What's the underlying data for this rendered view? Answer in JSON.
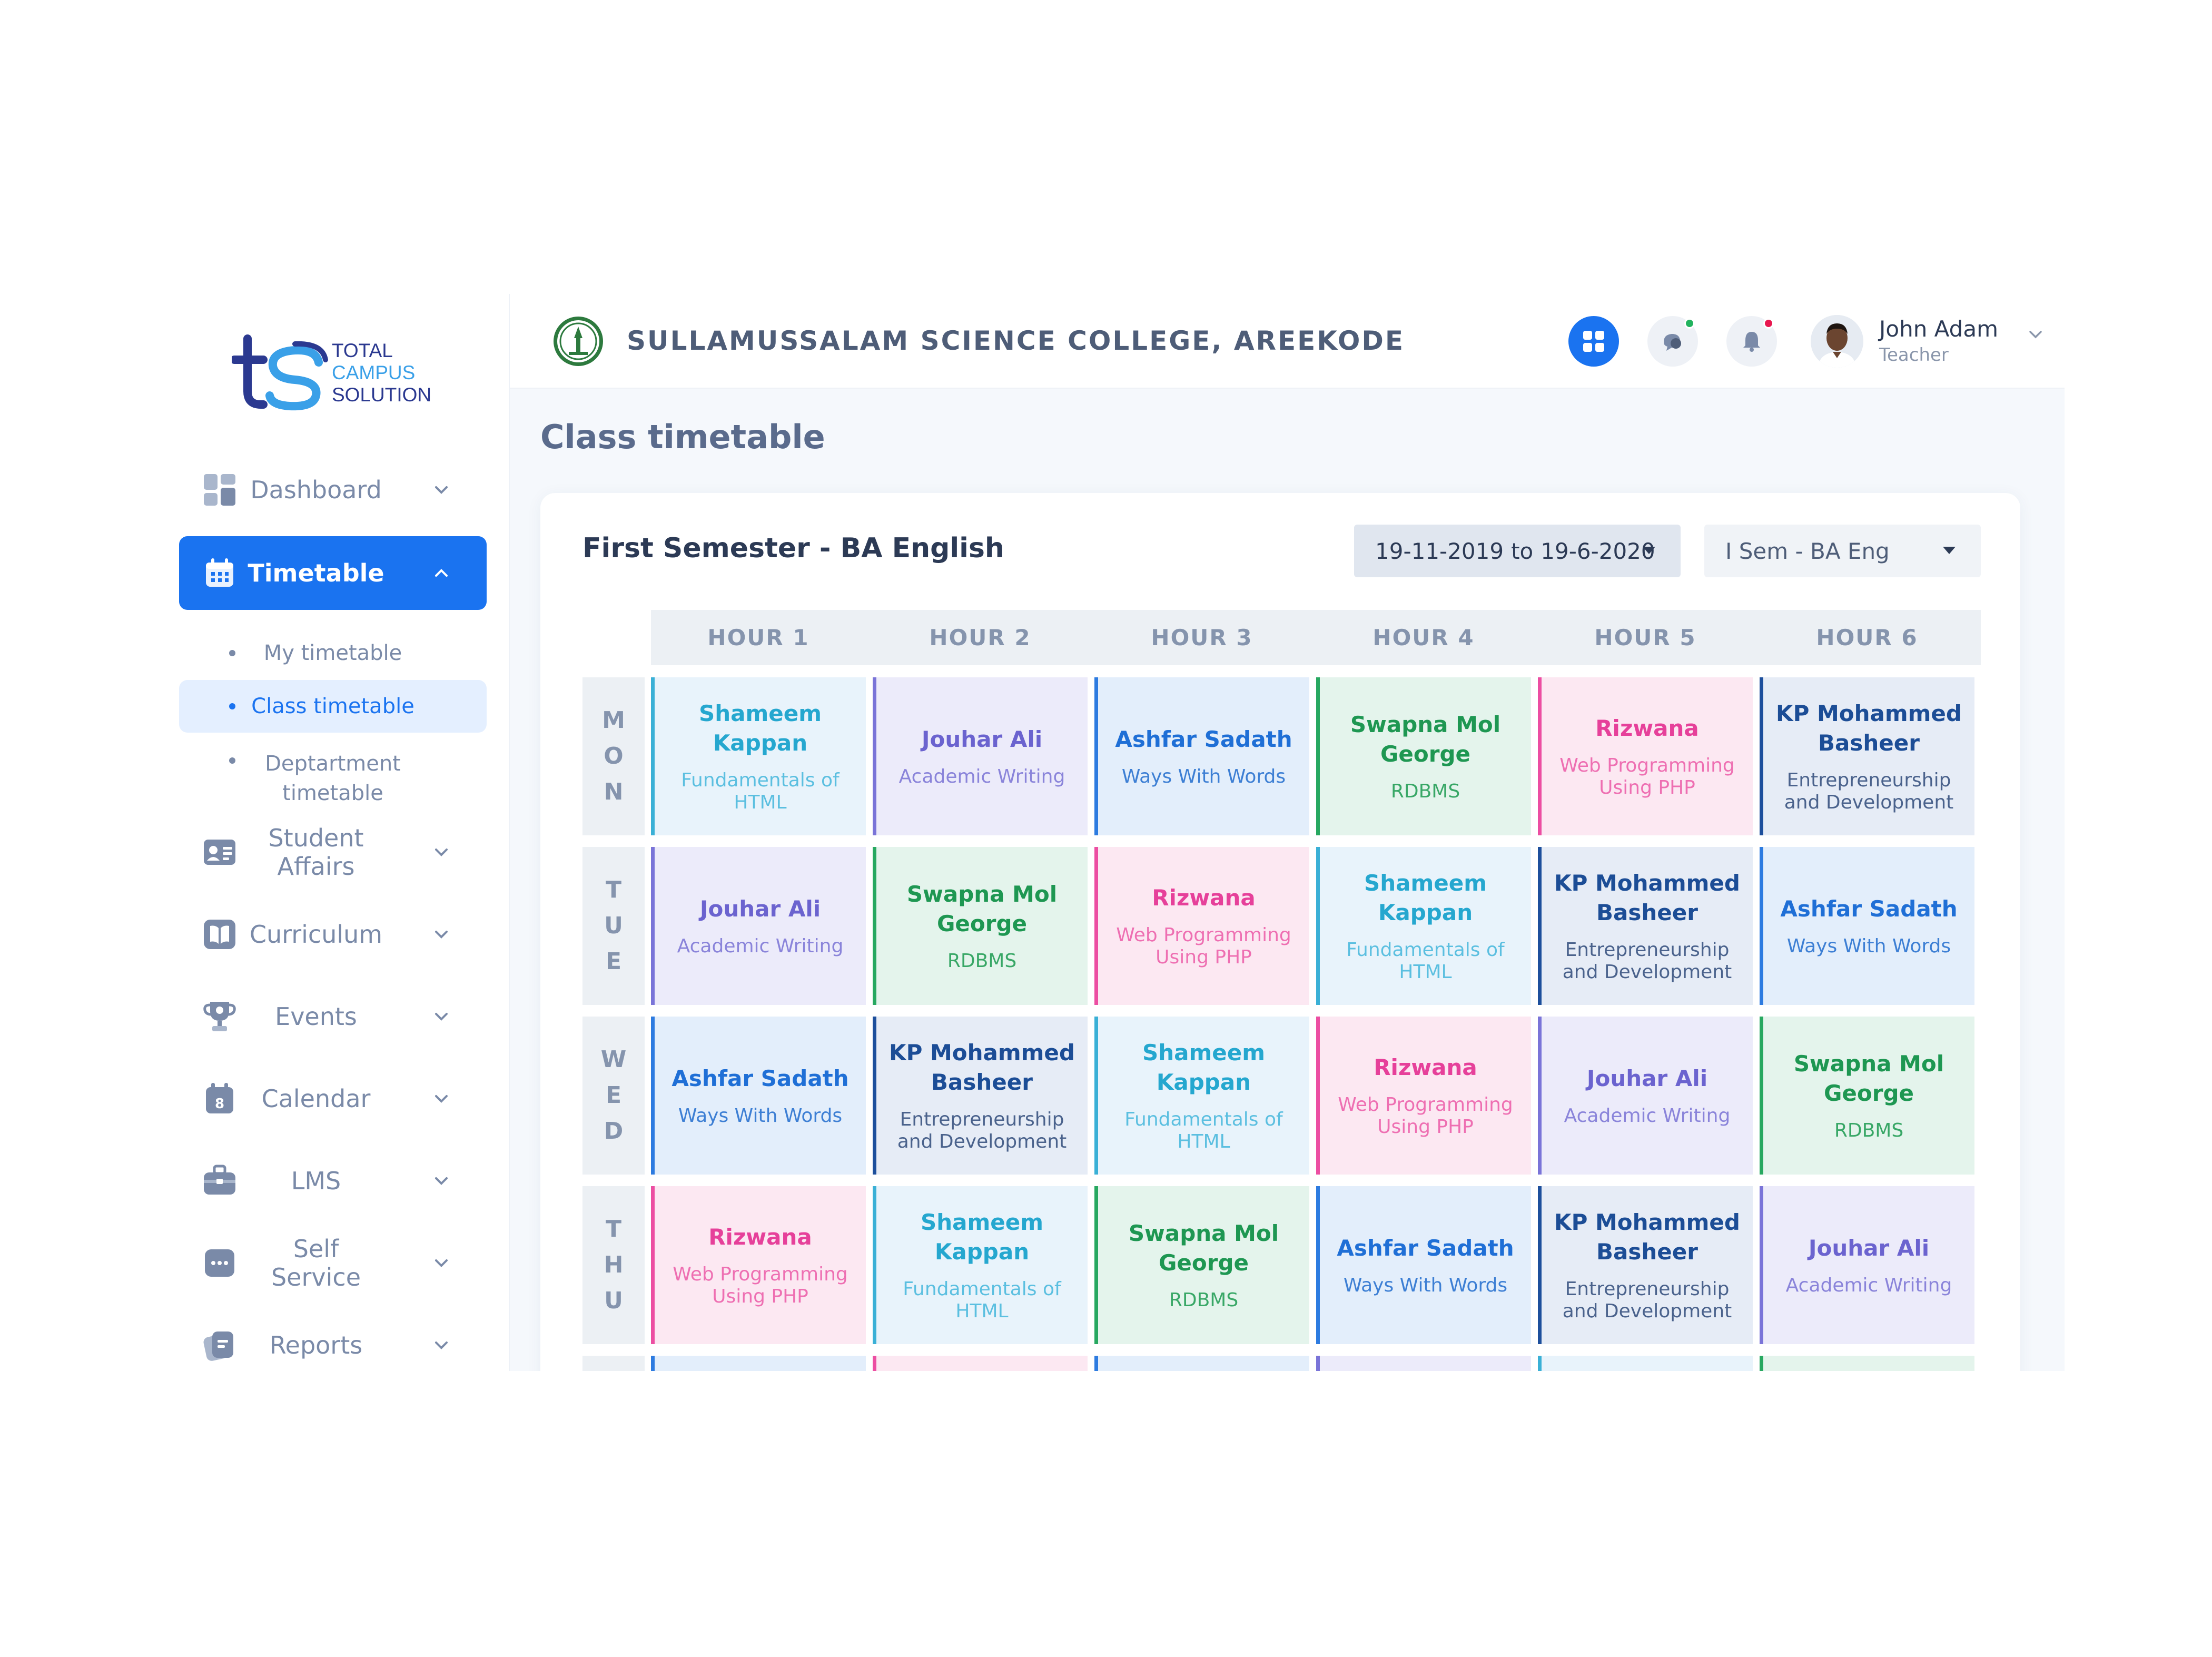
{
  "logo": {
    "line1": "TOTAL",
    "line2": "CAMPUS",
    "line3": "SOLUTION"
  },
  "sidebar": {
    "items": [
      {
        "label": "Dashboard",
        "icon": "dashboard-icon"
      },
      {
        "label": "Timetable",
        "icon": "calendar-grid-icon",
        "active": true
      },
      {
        "label": "Student Affairs",
        "icon": "id-card-icon"
      },
      {
        "label": "Curriculum",
        "icon": "book-icon"
      },
      {
        "label": "Events",
        "icon": "trophy-icon"
      },
      {
        "label": "Calendar",
        "icon": "calendar-icon",
        "badge": "8"
      },
      {
        "label": "LMS",
        "icon": "briefcase-icon"
      },
      {
        "label": "Self Service",
        "icon": "chat-dots-icon"
      },
      {
        "label": "Reports",
        "icon": "reports-icon"
      }
    ],
    "subitems": [
      {
        "label": "My timetable"
      },
      {
        "label": "Class timetable",
        "active": true
      },
      {
        "label": "Deptartment timetable"
      }
    ]
  },
  "header": {
    "college_name": "SULLAMUSSALAM SCIENCE COLLEGE, AREEKODE",
    "user": {
      "name": "John Adam",
      "role": "Teacher"
    }
  },
  "page": {
    "title": "Class timetable"
  },
  "card": {
    "title": "First Semester - BA English",
    "date_range": {
      "from": "19-11-2019",
      "sep": "to",
      "to": "19-6-2020"
    },
    "semester_select": "I Sem - BA Eng"
  },
  "timetable": {
    "hours": [
      "HOUR 1",
      "HOUR 2",
      "HOUR 3",
      "HOUR 4",
      "HOUR 5",
      "HOUR 6"
    ],
    "days": [
      {
        "letters": [
          "M",
          "O",
          "N"
        ],
        "slots": [
          {
            "teacher": "Shameem Kappan",
            "subject": "Fundamentals of HTML",
            "color": "teal"
          },
          {
            "teacher": "Jouhar Ali",
            "subject": "Academic Writing",
            "color": "purple"
          },
          {
            "teacher": "Ashfar Sadath",
            "subject": "Ways With Words",
            "color": "blue"
          },
          {
            "teacher": "Swapna Mol George",
            "subject": "RDBMS",
            "color": "green"
          },
          {
            "teacher": "Rizwana",
            "subject": "Web Programming Using PHP",
            "color": "pink"
          },
          {
            "teacher": "KP Mohammed Basheer",
            "subject": "Entrepreneurship and Development",
            "color": "navy"
          }
        ]
      },
      {
        "letters": [
          "T",
          "U",
          "E"
        ],
        "slots": [
          {
            "teacher": "Jouhar Ali",
            "subject": "Academic Writing",
            "color": "purple"
          },
          {
            "teacher": "Swapna Mol George",
            "subject": "RDBMS",
            "color": "green"
          },
          {
            "teacher": "Rizwana",
            "subject": "Web Programming Using PHP",
            "color": "pink"
          },
          {
            "teacher": "Shameem Kappan",
            "subject": "Fundamentals of HTML",
            "color": "teal"
          },
          {
            "teacher": "KP Mohammed Basheer",
            "subject": "Entrepreneurship and Development",
            "color": "navy"
          },
          {
            "teacher": "Ashfar Sadath",
            "subject": "Ways With Words",
            "color": "blue"
          }
        ]
      },
      {
        "letters": [
          "W",
          "E",
          "D"
        ],
        "slots": [
          {
            "teacher": "Ashfar Sadath",
            "subject": "Ways With Words",
            "color": "blue"
          },
          {
            "teacher": "KP Mohammed Basheer",
            "subject": "Entrepreneurship and Development",
            "color": "navy"
          },
          {
            "teacher": "Shameem Kappan",
            "subject": "Fundamentals of HTML",
            "color": "teal"
          },
          {
            "teacher": "Rizwana",
            "subject": "Web Programming Using PHP",
            "color": "pink"
          },
          {
            "teacher": "Jouhar Ali",
            "subject": "Academic Writing",
            "color": "purple"
          },
          {
            "teacher": "Swapna Mol George",
            "subject": "RDBMS",
            "color": "green"
          }
        ]
      },
      {
        "letters": [
          "T",
          "H",
          "U"
        ],
        "slots": [
          {
            "teacher": "Rizwana",
            "subject": "Web Programming Using PHP",
            "color": "pink"
          },
          {
            "teacher": "Shameem Kappan",
            "subject": "Fundamentals of HTML",
            "color": "teal"
          },
          {
            "teacher": "Swapna Mol George",
            "subject": "RDBMS",
            "color": "green"
          },
          {
            "teacher": "Ashfar Sadath",
            "subject": "Ways With Words",
            "color": "blue"
          },
          {
            "teacher": "KP Mohammed Basheer",
            "subject": "Entrepreneurship and Development",
            "color": "navy"
          },
          {
            "teacher": "Jouhar Ali",
            "subject": "Academic Writing",
            "color": "purple"
          }
        ]
      },
      {
        "letters": [],
        "slots": [
          {
            "teacher": "",
            "subject": "",
            "color": "blue"
          },
          {
            "teacher": "",
            "subject": "",
            "color": "pink"
          },
          {
            "teacher": "",
            "subject": "",
            "color": "blue"
          },
          {
            "teacher": "",
            "subject": "",
            "color": "purple"
          },
          {
            "teacher": "",
            "subject": "",
            "color": "teal"
          },
          {
            "teacher": "",
            "subject": "",
            "color": "green"
          }
        ]
      }
    ]
  },
  "colors": {
    "accent": "#1a73f0",
    "notification_dot": "#e8174f",
    "online_dot": "#22b35e"
  }
}
